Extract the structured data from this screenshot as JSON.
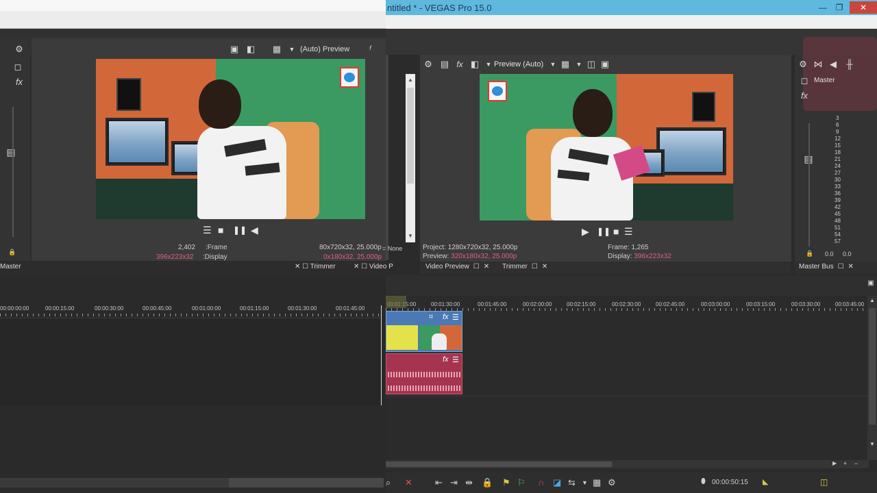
{
  "app": {
    "window_title": "ntitled * - VEGAS Pro 15.0",
    "min_glyph": "—",
    "max_glyph": "❐",
    "close_glyph": "✕"
  },
  "left_preview": {
    "mirrored_title_text": "(Auto) Preview",
    "frame_label": ":Frame",
    "frame_value": "2,402",
    "display_label": ":Display",
    "display_value": "396x223x32",
    "project_partial": "80x720x32, 25.000p",
    "preview_partial": "0x180x32, 25.000p",
    "left_edge_text": "= None",
    "tab_trimmer": "Trimmer",
    "tab_video": "Video P",
    "master_label": "Master"
  },
  "right_preview": {
    "preview_mode": "Preview (Auto)",
    "project_label": "Project:",
    "project_value": "1280x720x32, 25.000p",
    "preview_label": "Preview:",
    "preview_value": "320x180x32, 25.000p",
    "frame_label": "Frame:",
    "frame_value": "1,265",
    "display_label": "Display:",
    "display_value": "396x223x32",
    "tab_video_preview": "Video Preview",
    "tab_trimmer": "Trimmer"
  },
  "master": {
    "label": "Master",
    "tab_label": "Master Bus",
    "scale": [
      "3",
      "6",
      "9",
      "12",
      "15",
      "18",
      "21",
      "24",
      "27",
      "30",
      "33",
      "36",
      "39",
      "42",
      "45",
      "48",
      "51",
      "54",
      "57"
    ],
    "readout_left": "0.0",
    "readout_right": "0.0"
  },
  "timeline": {
    "right_ruler": [
      "00:01:15:00",
      "00:01:30:00",
      "00:01:45:00",
      "00:02:00:00",
      "00:02:15:00",
      "00:02:30:00",
      "00:02:45:00",
      "00:03:00:00",
      "00:03:15:00",
      "00:03:30:00",
      "00:03:45:00"
    ],
    "left_ruler": [
      "00:00:00:00",
      "00:00:15:00",
      "00:00:30:00",
      "00:00:45:00",
      "00:01:00:00",
      "00:01:15:00",
      "00:01:30:00",
      "00:01:45:00"
    ],
    "timecode": "00:00:50:15"
  },
  "colors": {
    "titlebar": "#5fb8de",
    "close_button": "#c7463e",
    "video_clip": "#4b79b6",
    "audio_clip": "#a4344f",
    "pink_text": "#e0607e"
  },
  "icons": {
    "gear": "⚙",
    "fx": "fx",
    "grid": "▦",
    "save": "▣",
    "play": "▶",
    "pause": "❚❚",
    "stop": "■",
    "menu": "☰",
    "close": "✕",
    "square": "☐",
    "lock": "🔒"
  }
}
